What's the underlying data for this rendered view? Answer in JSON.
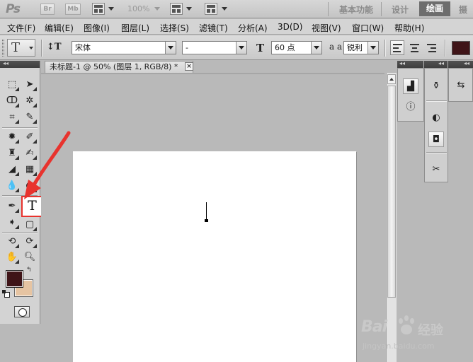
{
  "appbar": {
    "logo": "Ps",
    "bridge_label": "Br",
    "minibridge_label": "Mb",
    "zoom": "100%",
    "workspaces": [
      "基本功能",
      "设计",
      "绘画",
      "摄"
    ],
    "active_workspace": "绘画"
  },
  "menu": [
    "文件(F)",
    "编辑(E)",
    "图像(I)",
    "图层(L)",
    "选择(S)",
    "滤镜(T)",
    "分析(A)",
    "3D(D)",
    "视图(V)",
    "窗口(W)",
    "帮助(H)"
  ],
  "options": {
    "tool_glyph": "T",
    "orientation_glyph": "↕T",
    "font_family": "宋体",
    "font_style": "-",
    "size_glyph": "T",
    "font_size": "60 点",
    "aa_glyph": "a a",
    "antialias": "锐利",
    "text_color": "#3f1418"
  },
  "tools_panel": {
    "collapse_label": "◂◂",
    "type_tool_glyph": "T",
    "foreground_color": "#3f1418",
    "background_color": "#e6c4a2",
    "swap_glyph": "↰"
  },
  "document": {
    "tab_title": "未标题-1 @ 50% (图层 1, RGB/8) *",
    "close_glyph": "×"
  },
  "right_panels": {
    "collapse_left": "◂◂",
    "collapse_mid": "◂◂",
    "collapse_right": "◂◂"
  },
  "watermark": {
    "logo": "Bai",
    "logo_end": "百",
    "chinese": "经验",
    "url": "jingyan.baidu.com"
  },
  "accent": {
    "annotation_red": "#e8332e"
  }
}
